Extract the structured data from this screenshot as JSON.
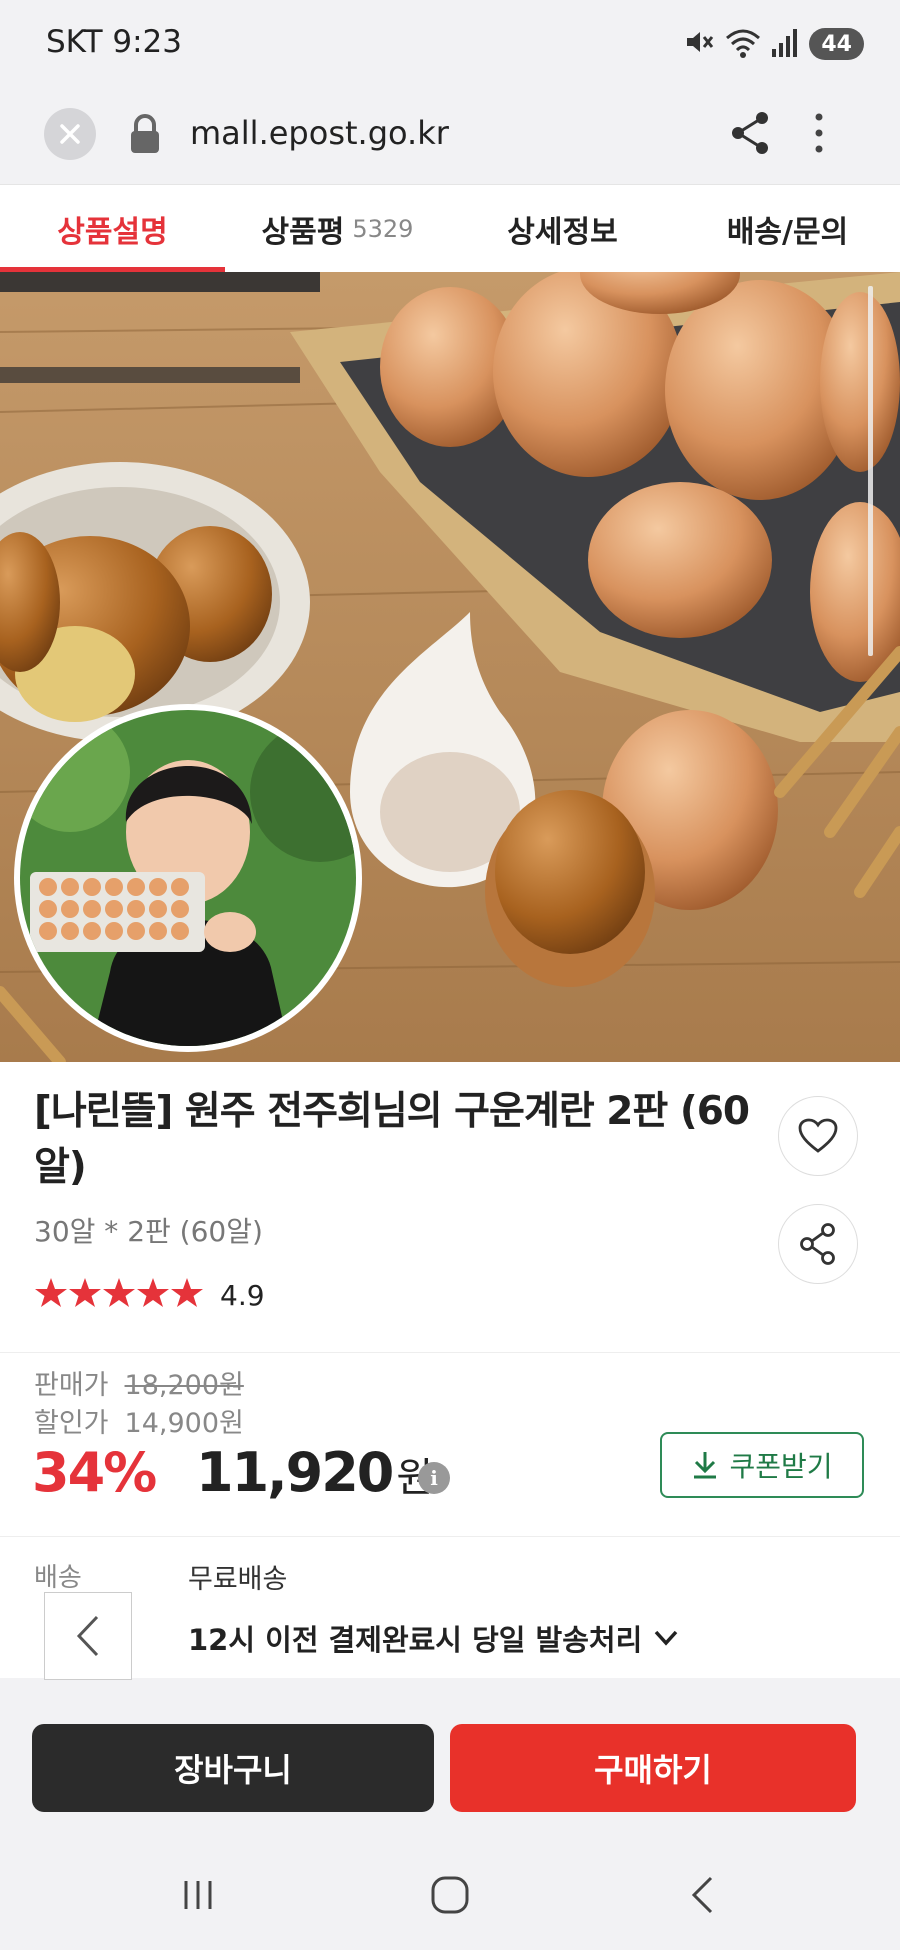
{
  "status_bar": {
    "carrier_time": "SKT 9:23",
    "battery": "44"
  },
  "browser": {
    "url": "mall.epost.go.kr"
  },
  "tabs": [
    {
      "label": "상품설명",
      "count": ""
    },
    {
      "label": "상품평",
      "count": "5329"
    },
    {
      "label": "상세정보",
      "count": ""
    },
    {
      "label": "배송/문의",
      "count": ""
    }
  ],
  "product": {
    "title": "[나린뜰] 원주 전주희님의 구운계란 2판 (60알)",
    "option": "30알 * 2판 (60알)",
    "rating": "4.9",
    "rating_stars": 5
  },
  "price": {
    "list_label": "판매가",
    "list_value": "18,200원",
    "discount_label": "할인가",
    "discount_value": "14,900원",
    "rate": "34%",
    "final": "11,920",
    "currency": "원",
    "coupon_label": "쿠폰받기"
  },
  "shipping": {
    "label": "배송",
    "value": "무료배송",
    "detail": "12시 이전 결제완료시 당일 발송처리"
  },
  "actions": {
    "cart": "장바구니",
    "buy": "구매하기"
  },
  "colors": {
    "accent": "#e5333a",
    "buy": "#e8312a",
    "cart": "#2b2b2b",
    "coupon": "#2e8b57"
  }
}
